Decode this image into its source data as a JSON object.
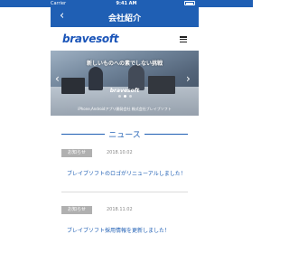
{
  "status_bar": {
    "carrier": "Carrier",
    "time": "9:41 AM"
  },
  "nav": {
    "back_icon": "‹",
    "title": "会社紹介"
  },
  "header": {
    "logo": "bravesoft",
    "menu_icon": "hamburger-menu-icon"
  },
  "hero": {
    "caption": "新しいものへの素でしない挑戦",
    "logo": "bravesoft",
    "footer": "iPhone,Androidアプリ開発会社  株式会社ブレイブソフト",
    "slides": 3,
    "active_slide": 1
  },
  "news": {
    "heading": "ニュース",
    "items": [
      {
        "badge": "お知らせ",
        "date": "2018.10.02",
        "text": "ブレイブソフトのロゴがリニューアルしました！"
      },
      {
        "badge": "お知らせ",
        "date": "2018.11.02",
        "text": "ブレイブソフト採用情報を更新しました！"
      }
    ]
  },
  "colors": {
    "brand_blue": "#1f5fb4",
    "badge_gray": "#b0b0b0"
  }
}
